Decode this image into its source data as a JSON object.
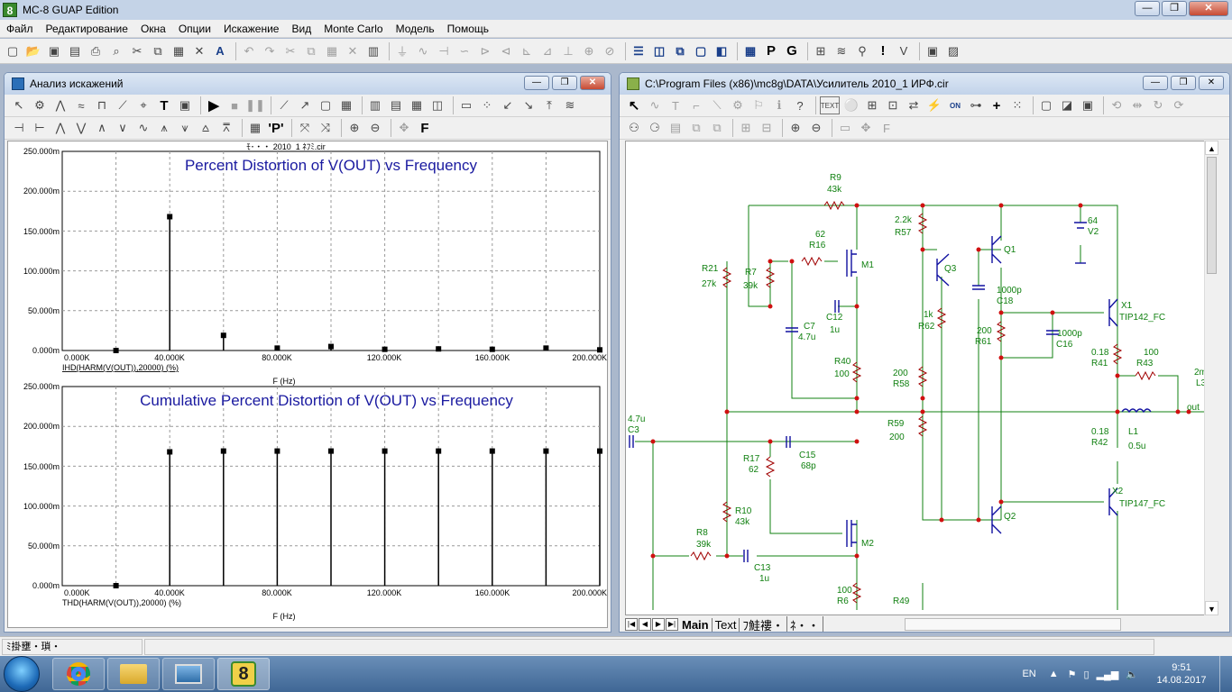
{
  "app": {
    "title": "MC-8 GUAP Edition",
    "icon_label": "8"
  },
  "menu": [
    "Файл",
    "Редактирование",
    "Окна",
    "Опции",
    "Искажение",
    "Вид",
    "Monte Carlo",
    "Модель",
    "Помощь"
  ],
  "analysis_window": {
    "title": "Анализ искажений",
    "file_label": "ﾓ･・・ 2010_1 ﾈﾌﾐ.cir",
    "plot1": {
      "title": "Percent Distortion of V(OUT) vs Frequency",
      "ytick_labels": [
        "250.000m",
        "200.000m",
        "150.000m",
        "100.000m",
        "50.000m",
        "0.000m"
      ],
      "xtick_labels": [
        "0.000K",
        "40.000K",
        "80.000K",
        "120.000K",
        "160.000K",
        "200.000K"
      ],
      "expr_label": "IHD(HARM(V(OUT)),20000) (%)",
      "xlabel": "F (Hz)"
    },
    "plot2": {
      "title": "Cumulative Percent Distortion of V(OUT) vs Frequency",
      "ytick_labels": [
        "250.000m",
        "200.000m",
        "150.000m",
        "100.000m",
        "50.000m",
        "0.000m"
      ],
      "xtick_labels": [
        "0.000K",
        "40.000K",
        "80.000K",
        "120.000K",
        "160.000K",
        "200.000K"
      ],
      "expr_label": "THD(HARM(V(OUT)),20000) (%)",
      "xlabel": "F (Hz)"
    }
  },
  "chart_data": [
    {
      "type": "scatter",
      "title": "Percent Distortion of V(OUT) vs Frequency",
      "xlabel": "F (Hz)",
      "ylabel": "IHD(HARM(V(OUT)),20000) (%)",
      "x_unit": "K",
      "y_unit": "m",
      "xlim": [
        0,
        200
      ],
      "ylim": [
        0,
        250
      ],
      "grid": true,
      "x": [
        20,
        40,
        60,
        80,
        100,
        120,
        140,
        160,
        180,
        200
      ],
      "y": [
        0,
        168,
        19,
        3,
        5,
        1.5,
        2,
        1.5,
        3,
        0.8
      ]
    },
    {
      "type": "scatter",
      "title": "Cumulative Percent Distortion of V(OUT) vs Frequency",
      "xlabel": "F (Hz)",
      "ylabel": "THD(HARM(V(OUT)),20000) (%)",
      "x_unit": "K",
      "y_unit": "m",
      "xlim": [
        0,
        200
      ],
      "ylim": [
        0,
        250
      ],
      "grid": true,
      "x": [
        20,
        40,
        60,
        80,
        100,
        120,
        140,
        160,
        180,
        200
      ],
      "y": [
        0,
        168,
        169,
        169,
        169,
        169,
        169,
        169,
        169,
        169
      ]
    }
  ],
  "schematic_window": {
    "title": "C:\\Program Files (x86)\\mc8g\\DATA\\Усилитель 2010_1  ИРФ.cir",
    "tabs": [
      "Main",
      "Text",
      "ﾌ鮭褸・",
      "ﾈ・・"
    ],
    "labels": {
      "r9": "R9",
      "r9v": "43k",
      "r16n": "62",
      "r16": "R16",
      "m1": "M1",
      "r21": "R21",
      "r21v": "27k",
      "r7": "R7",
      "r7v": "39k",
      "c12": "C12",
      "c12v": "1u",
      "c7": "C7",
      "c7v": "4.7u",
      "r40": "R40",
      "r40v": "100",
      "r57v": "2.2k",
      "r57": "R57",
      "q3": "Q3",
      "r62v": "1k",
      "r62": "R62",
      "q1": "Q1",
      "c18v": "1000p",
      "c18": "C18",
      "v2v": "64",
      "v2": "V2",
      "r61v": "200",
      "r61": "R61",
      "c16v": "1000p",
      "c16": "C16",
      "x1": "X1",
      "x1m": "TIP142_FC",
      "r41v": "0.18",
      "r41": "R41",
      "r43v": "100",
      "r43": "R43",
      "l3v": "2m",
      "l3": "L3",
      "out": "out",
      "r58v": "200",
      "r58": "R58",
      "r59": "R59",
      "r59v": "200",
      "c3v": "4.7u",
      "c3": "C3",
      "r42v": "0.18",
      "r42": "R42",
      "l1": "L1",
      "l1v": "0.5u",
      "r17": "R17",
      "r17v": "62",
      "c15": "C15",
      "c15v": "68p",
      "x2": "X2",
      "x2m": "TIP147_FC",
      "r10": "R10",
      "r10v": "43k",
      "r8": "R8",
      "r8v": "39k",
      "c13": "C13",
      "c13v": "1u",
      "m2": "M2",
      "q2": "Q2",
      "r6v": "100",
      "r6": "R6",
      "r49": "R49"
    },
    "text_button": "TEXT",
    "on_label": "ON"
  },
  "statusbar": {
    "text": "ﾐ掛壅・瑣・"
  },
  "tray": {
    "lang": "EN",
    "time": "9:51",
    "date": "14.08.2017"
  }
}
